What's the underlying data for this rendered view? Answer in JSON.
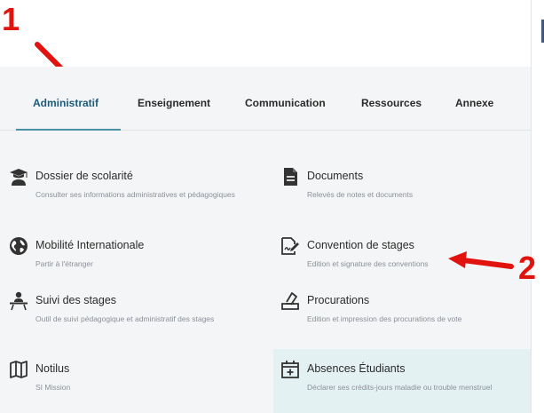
{
  "tabs": [
    {
      "label": "Administratif",
      "active": true
    },
    {
      "label": "Enseignement",
      "active": false
    },
    {
      "label": "Communication",
      "active": false
    },
    {
      "label": "Ressources",
      "active": false
    },
    {
      "label": "Annexe",
      "active": false
    }
  ],
  "cards": [
    {
      "title": "Dossier de scolarité",
      "desc": "Consulter ses informations administratives et pédagogiques",
      "icon": "graduate-icon"
    },
    {
      "title": "Documents",
      "desc": "Relevés de notes et documents",
      "icon": "document-icon"
    },
    {
      "title": "Mobilité Internationale",
      "desc": "Partir à l'étranger",
      "icon": "globe-icon"
    },
    {
      "title": "Convention de stages",
      "desc": "Edition et signature des conventions",
      "icon": "signature-icon"
    },
    {
      "title": "Suivi des stages",
      "desc": "Outil de suivi pédagogique et administratif des stages",
      "icon": "mentor-icon"
    },
    {
      "title": "Procurations",
      "desc": "Edition et impression des procurations de vote",
      "icon": "ballot-icon"
    },
    {
      "title": "Notilus",
      "desc": "SI Mission",
      "icon": "map-icon"
    },
    {
      "title": "Absences Étudiants",
      "desc": "Déclarer ses crédits-jours maladie ou trouble menstruel",
      "icon": "calendar-plus-icon"
    }
  ],
  "annotations": {
    "marker_1": "1",
    "marker_2": "2"
  },
  "colors": {
    "annotation": "#e0130f",
    "active_tab": "#1d5b7a",
    "tab_underline": "#4a90a4",
    "highlight_card": "#e4f1f3",
    "panel": "#f4f5f6"
  }
}
